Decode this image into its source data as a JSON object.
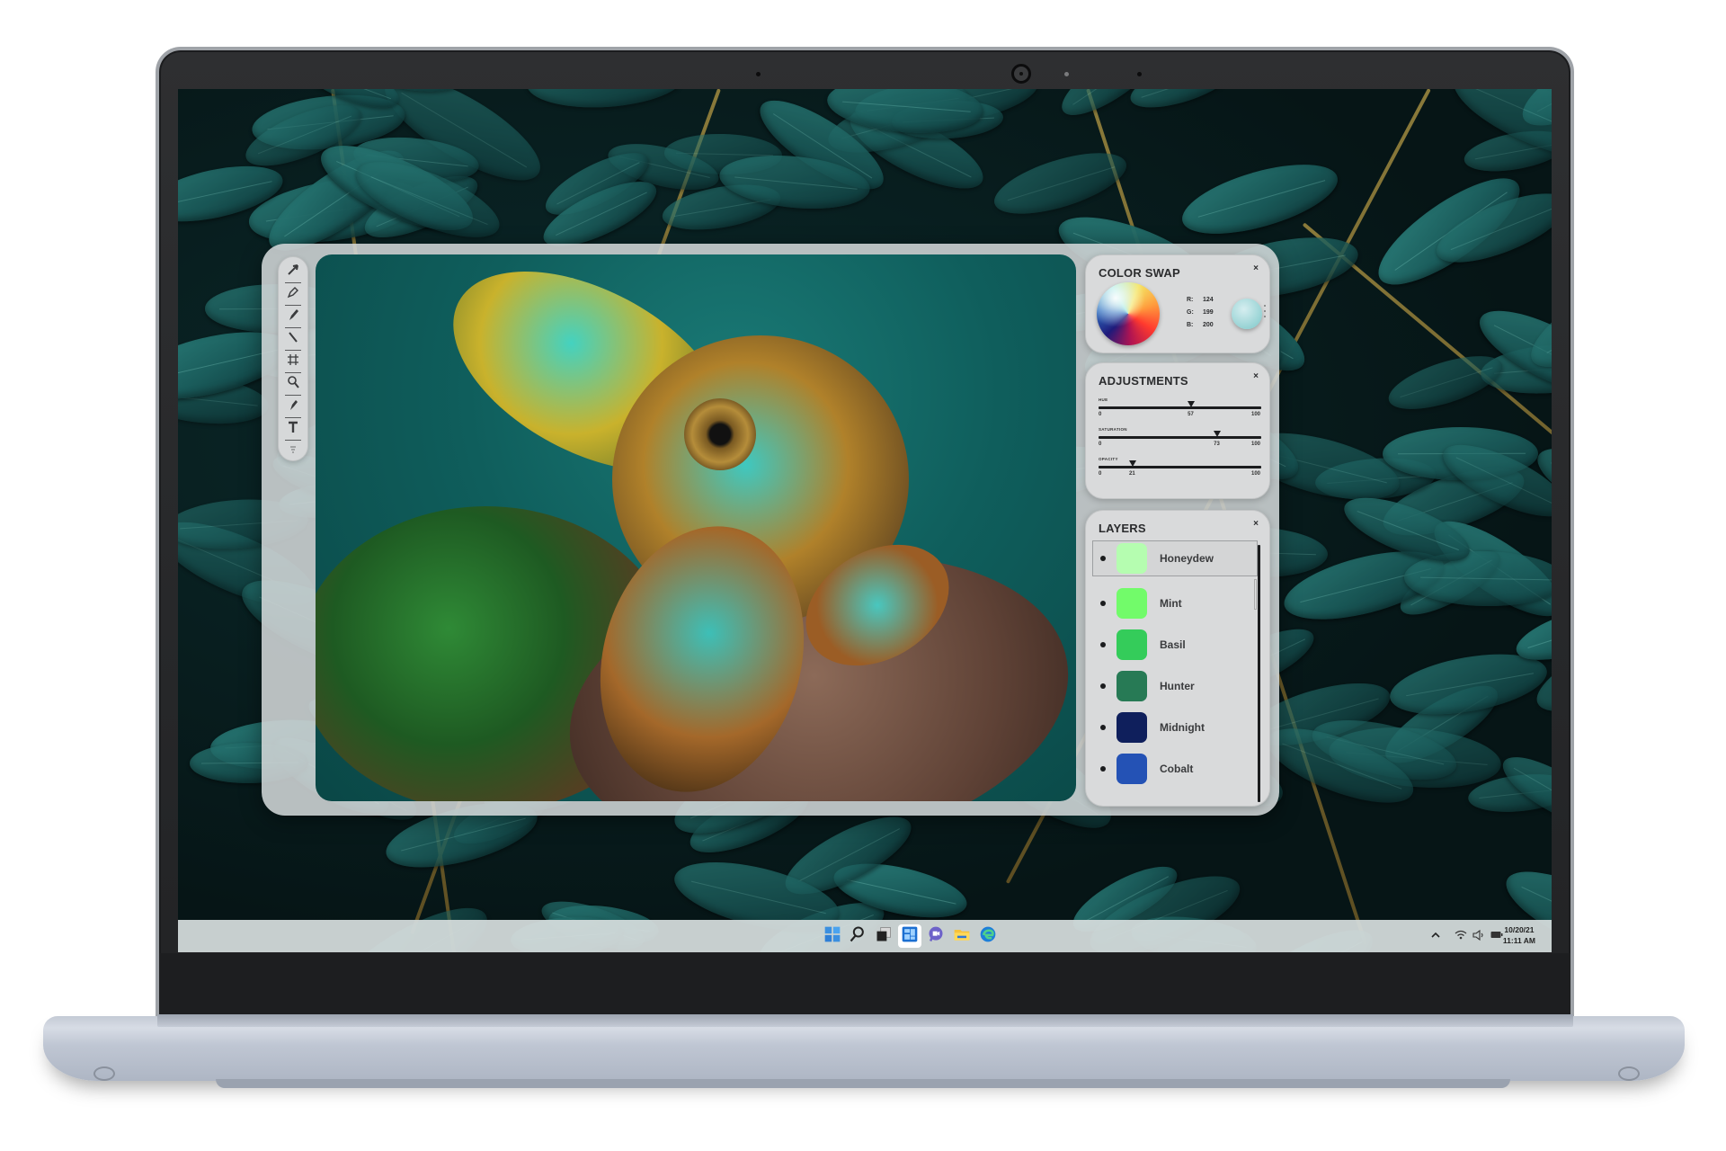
{
  "app": {
    "tools": [
      {
        "name": "move-tool",
        "icon": "arrow-pointer-icon"
      },
      {
        "name": "pen-tool",
        "icon": "pen-nib-icon"
      },
      {
        "name": "brush-tool",
        "icon": "brush-icon"
      },
      {
        "name": "line-tool",
        "icon": "line-icon"
      },
      {
        "name": "crop-tool",
        "icon": "crop-frame-icon"
      },
      {
        "name": "zoom-tool",
        "icon": "magnifier-icon"
      },
      {
        "name": "eyedropper-tool",
        "icon": "dropper-icon"
      },
      {
        "name": "text-tool",
        "icon": "text-T-icon",
        "glyph": "T"
      },
      {
        "name": "more-tools",
        "icon": "more-icon"
      }
    ],
    "color_swap": {
      "title": "COLOR SWAP",
      "close": "×",
      "r_label": "R:",
      "r_value": "124",
      "g_label": "G:",
      "g_value": "199",
      "b_label": "B:",
      "b_value": "200",
      "current_color": "#7cc7c8"
    },
    "adjustments": {
      "title": "ADJUSTMENTS",
      "close": "×",
      "sliders": [
        {
          "label": "HUE",
          "min": "0",
          "max": "100",
          "value": 57
        },
        {
          "label": "SATURATION",
          "min": "0",
          "max": "100",
          "value": 73
        },
        {
          "label": "OPACITY",
          "min": "0",
          "max": "100",
          "value": 21
        }
      ]
    },
    "layers": {
      "title": "LAYERS",
      "close": "×",
      "items": [
        {
          "name": "Honeydew",
          "color": "#b5fdb0",
          "selected": true
        },
        {
          "name": "Mint",
          "color": "#72fb6a"
        },
        {
          "name": "Basil",
          "color": "#34cc5a"
        },
        {
          "name": "Hunter",
          "color": "#277a55"
        },
        {
          "name": "Midnight",
          "color": "#0f1f5c"
        },
        {
          "name": "Cobalt",
          "color": "#2452b5"
        }
      ]
    }
  },
  "taskbar": {
    "apps": [
      {
        "name": "start",
        "icon": "windows-logo-icon"
      },
      {
        "name": "search",
        "icon": "search-icon"
      },
      {
        "name": "task-view",
        "icon": "task-view-icon"
      },
      {
        "name": "widgets",
        "icon": "widgets-icon",
        "active": true
      },
      {
        "name": "chat",
        "icon": "chat-camera-icon"
      },
      {
        "name": "file-explorer",
        "icon": "folder-icon"
      },
      {
        "name": "edge",
        "icon": "edge-browser-icon"
      }
    ],
    "tray": {
      "overflow": "^",
      "date": "10/20/21",
      "time": "11:11 AM"
    }
  }
}
